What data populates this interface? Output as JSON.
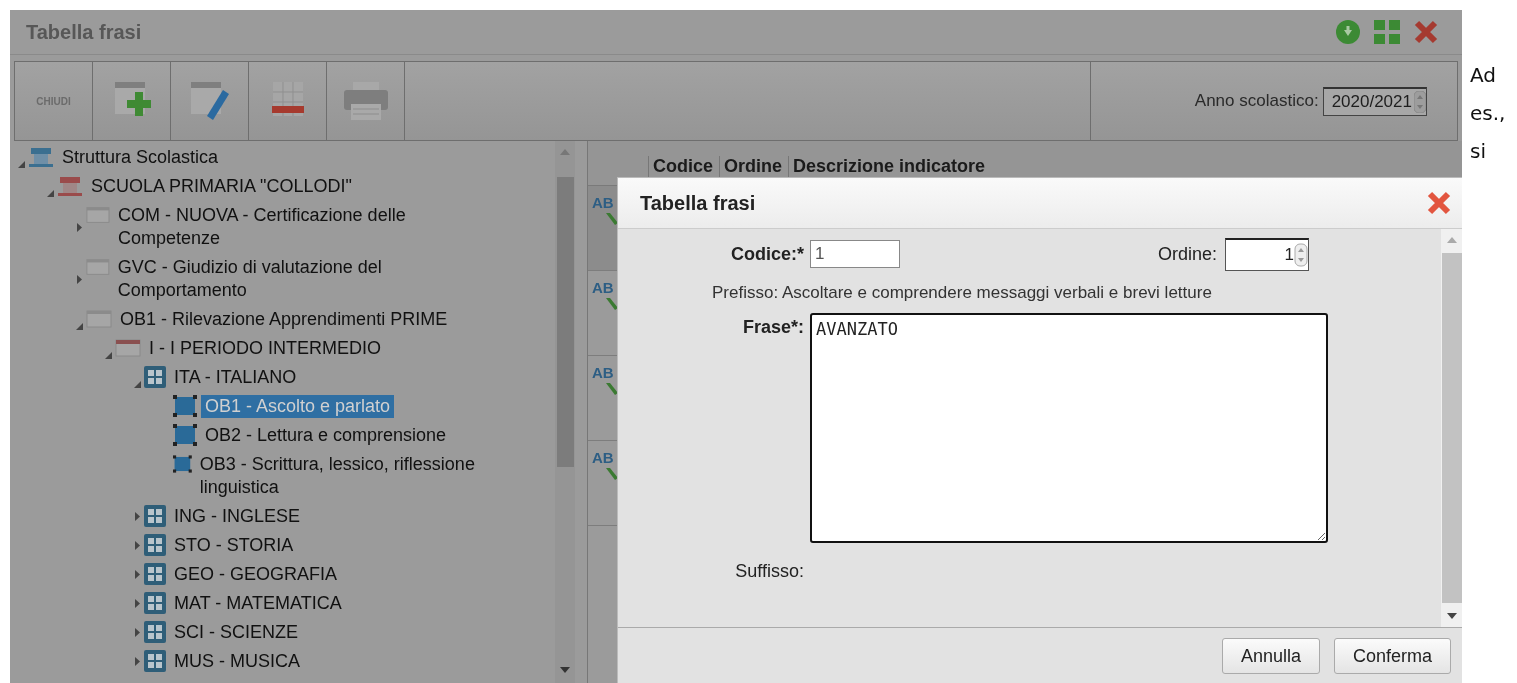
{
  "window": {
    "title": "Tabella frasi"
  },
  "toolbar": [
    {
      "kind": "text",
      "label": "CHIUDI"
    },
    {
      "kind": "add"
    },
    {
      "kind": "edit"
    },
    {
      "kind": "delete"
    },
    {
      "kind": "print"
    }
  ],
  "year": {
    "label": "Anno scolastico:",
    "value": "2020/2021"
  },
  "tree": [
    {
      "label": "Struttura Scolastica",
      "kind": "root",
      "expanded": true,
      "selected": false,
      "children": [
        {
          "label": "SCUOLA PRIMARIA \"COLLODI\"",
          "kind": "school",
          "expanded": true,
          "selected": false,
          "children": [
            {
              "label": "COM - NUOVA - Certificazione delle Competenze",
              "kind": "folder",
              "expanded": false,
              "selected": false
            },
            {
              "label": "GVC - Giudizio di valutazione del Comportamento",
              "kind": "folder",
              "expanded": false,
              "selected": false
            },
            {
              "label": "OB1 - Rilevazione Apprendimenti PRIME",
              "kind": "folder",
              "expanded": true,
              "selected": false,
              "children": [
                {
                  "label": "I - I PERIODO INTERMEDIO",
                  "kind": "period",
                  "expanded": true,
                  "selected": false,
                  "children": [
                    {
                      "label": "ITA - ITALIANO",
                      "kind": "subject",
                      "expanded": true,
                      "selected": false,
                      "children": [
                        {
                          "label": "OB1 - Ascolto e parlato",
                          "kind": "objective",
                          "selected": true
                        },
                        {
                          "label": "OB2 - Lettura e comprensione",
                          "kind": "objective",
                          "selected": false
                        },
                        {
                          "label": "OB3 - Scrittura, lessico, riflessione linguistica",
                          "kind": "objective",
                          "selected": false
                        }
                      ]
                    },
                    {
                      "label": "ING - INGLESE",
                      "kind": "subject",
                      "expanded": false,
                      "selected": false
                    },
                    {
                      "label": "STO - STORIA",
                      "kind": "subject",
                      "expanded": false,
                      "selected": false
                    },
                    {
                      "label": "GEO - GEOGRAFIA",
                      "kind": "subject",
                      "expanded": false,
                      "selected": false
                    },
                    {
                      "label": "MAT - MATEMATICA",
                      "kind": "subject",
                      "expanded": false,
                      "selected": false
                    },
                    {
                      "label": "SCI - SCIENZE",
                      "kind": "subject",
                      "expanded": false,
                      "selected": false
                    },
                    {
                      "label": "MUS - MUSICA",
                      "kind": "subject",
                      "expanded": false,
                      "selected": false
                    }
                  ]
                }
              ]
            }
          ]
        }
      ]
    }
  ],
  "table": {
    "columns": [
      "Codice",
      "Ordine",
      "Descrizione indicatore"
    ],
    "rows": [
      {
        "selected": true,
        "icon_text": "AB"
      },
      {
        "selected": false,
        "icon_text": "AB"
      },
      {
        "selected": false,
        "icon_text": "AB"
      },
      {
        "selected": false,
        "icon_text": "AB"
      }
    ]
  },
  "dialog": {
    "title": "Tabella frasi",
    "codice": {
      "label": "Codice:*",
      "value": "1"
    },
    "ordine": {
      "label": "Ordine:",
      "value": "1"
    },
    "prefisso": "Prefisso: Ascoltare e comprendere messaggi verbali e brevi letture",
    "frase": {
      "label": "Frase*:",
      "value": "AVANZATO"
    },
    "suffisso": "Suffisso:",
    "buttons": [
      "Annulla",
      "Conferma"
    ]
  },
  "side_text": [
    "Ad",
    "es.,",
    "si"
  ]
}
